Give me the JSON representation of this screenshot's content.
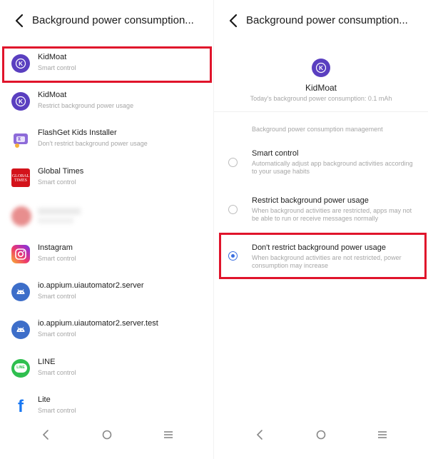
{
  "left": {
    "title": "Background power consumption...",
    "apps": [
      {
        "name": "KidMoat",
        "status": "Smart control",
        "icon": "kidmoat-icon"
      },
      {
        "name": "KidMoat",
        "status": "Restrict background power usage",
        "icon": "kidmoat-icon"
      },
      {
        "name": "FlashGet Kids Installer",
        "status": "Don't restrict background power usage",
        "icon": "flashget-icon"
      },
      {
        "name": "Global Times",
        "status": "Smart control",
        "icon": "global-times-icon",
        "icon_text": "GLOBAL TIMES"
      },
      {
        "name": "",
        "status": "",
        "icon": "blurred-app-icon"
      },
      {
        "name": "Instagram",
        "status": "Smart control",
        "icon": "instagram-icon"
      },
      {
        "name": "io.appium.uiautomator2.server",
        "status": "Smart control",
        "icon": "android-icon"
      },
      {
        "name": "io.appium.uiautomator2.server.test",
        "status": "Smart control",
        "icon": "android-icon"
      },
      {
        "name": "LINE",
        "status": "Smart control",
        "icon": "line-icon",
        "icon_text": "LINE"
      },
      {
        "name": "Lite",
        "status": "Smart control",
        "icon": "facebook-lite-icon",
        "icon_text": "f"
      }
    ]
  },
  "right": {
    "title": "Background power consumption...",
    "app_name": "KidMoat",
    "consumption_text": "Today's background power consumption: 0.1 mAh",
    "section_header": "Background power consumption management",
    "options": [
      {
        "title": "Smart control",
        "desc": "Automatically adjust app background activities according to your usage habits",
        "selected": false
      },
      {
        "title": "Restrict background power usage",
        "desc": "When background activities are restricted, apps may not be able to run or receive messages normally",
        "selected": false
      },
      {
        "title": "Don't restrict background power usage",
        "desc": "When background activities are not restricted, power consumption may increase",
        "selected": true
      }
    ]
  },
  "colors": {
    "highlight": "#e0142b",
    "accent": "#3b6fe0",
    "kidmoat": "#5a3fc0"
  }
}
